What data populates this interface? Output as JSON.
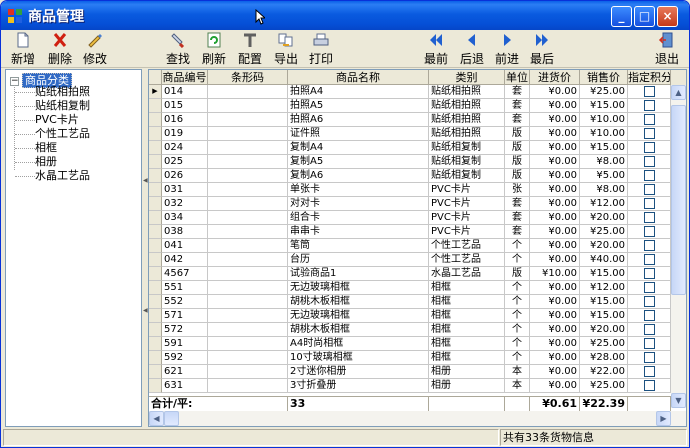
{
  "window": {
    "title": "商品管理",
    "minimize": "_",
    "maximize": "□",
    "close": "×"
  },
  "toolbar": {
    "add": "新增",
    "delete": "删除",
    "edit": "修改",
    "find": "查找",
    "refresh": "刷新",
    "config": "配置",
    "export": "导出",
    "print": "打印",
    "first": "最前",
    "prev": "后退",
    "next": "前进",
    "last": "最后",
    "exit": "退出"
  },
  "tree": {
    "root": "商品分类",
    "expander": "−",
    "items": [
      "贴纸相拍照",
      "贴纸相复制",
      "PVC卡片",
      "个性工艺品",
      "相框",
      "相册",
      "水晶工艺品"
    ]
  },
  "grid": {
    "columns": [
      "商品编号",
      "条形码",
      "商品名称",
      "类别",
      "单位",
      "进货价",
      "销售价",
      "指定积分"
    ],
    "rows": [
      {
        "code": "014",
        "barcode": "",
        "name": "拍照A4",
        "category": "贴纸相拍照",
        "unit": "套",
        "cost": "¥0.00",
        "price": "¥25.00"
      },
      {
        "code": "015",
        "barcode": "",
        "name": "拍照A5",
        "category": "贴纸相拍照",
        "unit": "套",
        "cost": "¥0.00",
        "price": "¥15.00"
      },
      {
        "code": "016",
        "barcode": "",
        "name": "拍照A6",
        "category": "贴纸相拍照",
        "unit": "套",
        "cost": "¥0.00",
        "price": "¥10.00"
      },
      {
        "code": "019",
        "barcode": "",
        "name": "证件照",
        "category": "贴纸相拍照",
        "unit": "版",
        "cost": "¥0.00",
        "price": "¥10.00"
      },
      {
        "code": "024",
        "barcode": "",
        "name": "复制A4",
        "category": "贴纸相复制",
        "unit": "版",
        "cost": "¥0.00",
        "price": "¥15.00"
      },
      {
        "code": "025",
        "barcode": "",
        "name": "复制A5",
        "category": "贴纸相复制",
        "unit": "版",
        "cost": "¥0.00",
        "price": "¥8.00"
      },
      {
        "code": "026",
        "barcode": "",
        "name": "复制A6",
        "category": "贴纸相复制",
        "unit": "版",
        "cost": "¥0.00",
        "price": "¥5.00"
      },
      {
        "code": "031",
        "barcode": "",
        "name": "单张卡",
        "category": "PVC卡片",
        "unit": "张",
        "cost": "¥0.00",
        "price": "¥8.00"
      },
      {
        "code": "032",
        "barcode": "",
        "name": "对对卡",
        "category": "PVC卡片",
        "unit": "套",
        "cost": "¥0.00",
        "price": "¥12.00"
      },
      {
        "code": "034",
        "barcode": "",
        "name": "组合卡",
        "category": "PVC卡片",
        "unit": "套",
        "cost": "¥0.00",
        "price": "¥20.00"
      },
      {
        "code": "038",
        "barcode": "",
        "name": "串串卡",
        "category": "PVC卡片",
        "unit": "套",
        "cost": "¥0.00",
        "price": "¥25.00"
      },
      {
        "code": "041",
        "barcode": "",
        "name": "笔筒",
        "category": "个性工艺品",
        "unit": "个",
        "cost": "¥0.00",
        "price": "¥20.00"
      },
      {
        "code": "042",
        "barcode": "",
        "name": "台历",
        "category": "个性工艺品",
        "unit": "个",
        "cost": "¥0.00",
        "price": "¥40.00"
      },
      {
        "code": "4567",
        "barcode": "",
        "name": "试验商品1",
        "category": "水晶工艺品",
        "unit": "版",
        "cost": "¥10.00",
        "price": "¥15.00"
      },
      {
        "code": "551",
        "barcode": "",
        "name": "无边玻璃相框",
        "category": "相框",
        "unit": "个",
        "cost": "¥0.00",
        "price": "¥12.00"
      },
      {
        "code": "552",
        "barcode": "",
        "name": "胡桃木板相框",
        "category": "相框",
        "unit": "个",
        "cost": "¥0.00",
        "price": "¥15.00"
      },
      {
        "code": "571",
        "barcode": "",
        "name": "无边玻璃相框",
        "category": "相框",
        "unit": "个",
        "cost": "¥0.00",
        "price": "¥15.00"
      },
      {
        "code": "572",
        "barcode": "",
        "name": "胡桃木板相框",
        "category": "相框",
        "unit": "个",
        "cost": "¥0.00",
        "price": "¥20.00"
      },
      {
        "code": "591",
        "barcode": "",
        "name": "A4时尚相框",
        "category": "相框",
        "unit": "个",
        "cost": "¥0.00",
        "price": "¥25.00"
      },
      {
        "code": "592",
        "barcode": "",
        "name": "10寸玻璃相框",
        "category": "相框",
        "unit": "个",
        "cost": "¥0.00",
        "price": "¥28.00"
      },
      {
        "code": "621",
        "barcode": "",
        "name": "2寸迷你相册",
        "category": "相册",
        "unit": "本",
        "cost": "¥0.00",
        "price": "¥22.00"
      },
      {
        "code": "631",
        "barcode": "",
        "name": "3寸折叠册",
        "category": "相册",
        "unit": "本",
        "cost": "¥0.00",
        "price": "¥25.00"
      }
    ],
    "summary": {
      "label": "合计/平:",
      "count": "33",
      "cost": "¥0.61",
      "price": "¥22.39"
    },
    "current_row_marker": "▶"
  },
  "status": {
    "message": "共有33条货物信息"
  },
  "colors": {
    "titlebar": "#0a5be0",
    "selection": "#316ac5",
    "frame": "#ece9d8"
  }
}
